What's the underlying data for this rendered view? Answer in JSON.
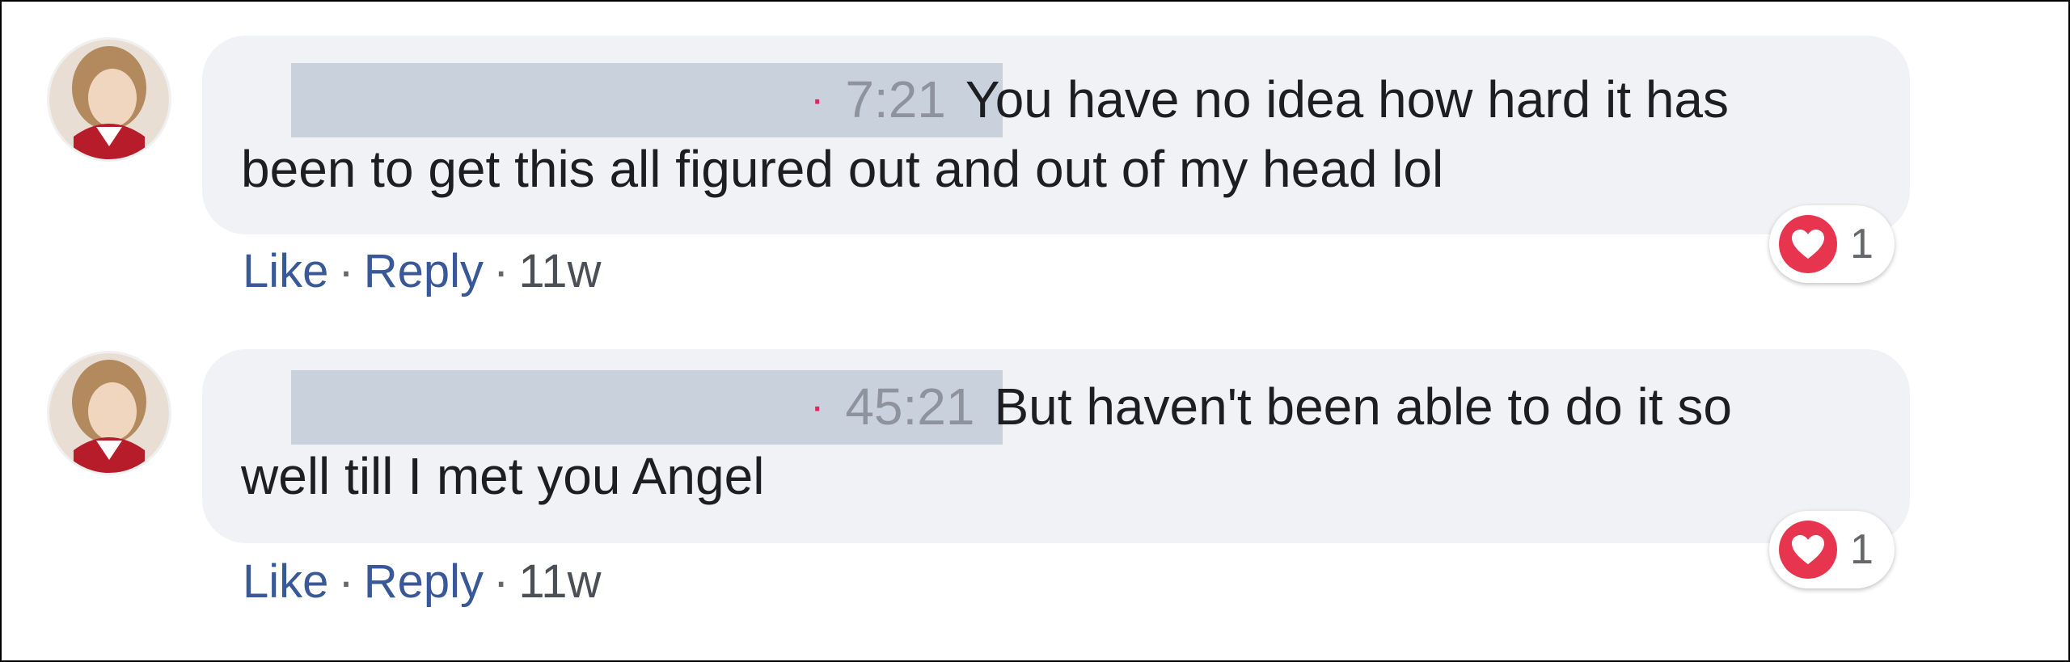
{
  "comments": [
    {
      "timestamp": "7:21",
      "text_line1": "You have no idea how hard it has",
      "text_line2": "been to get this all figured out and out of my head lol",
      "reaction": {
        "icon": "heart-icon",
        "count": "1"
      },
      "actions": {
        "like": "Like",
        "reply": "Reply",
        "age": "11w",
        "separator": "·"
      }
    },
    {
      "timestamp": "45:21",
      "text_line1": "But haven't been able to do it so",
      "text_line2": "well till I met you Angel",
      "reaction": {
        "icon": "heart-icon",
        "count": "1"
      },
      "actions": {
        "like": "Like",
        "reply": "Reply",
        "age": "11w",
        "separator": "·"
      }
    }
  ],
  "colors": {
    "bubble": "#f0f2f5",
    "link": "#385898",
    "timestamp": "#8d949e",
    "heart": "#e8354f",
    "redaction": "#c9d1dc"
  }
}
